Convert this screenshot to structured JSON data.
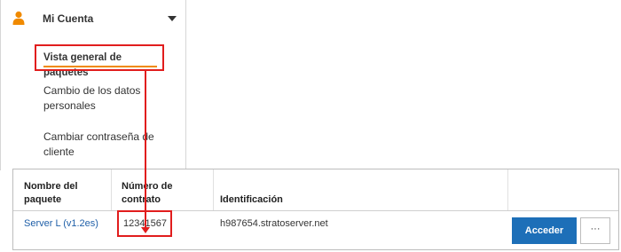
{
  "sidebar": {
    "account_label": "Mi Cuenta",
    "items": [
      {
        "label": "Vista general de paquetes"
      },
      {
        "label": "Cambio de los datos personales"
      },
      {
        "label": "Cambiar contraseña de cliente"
      }
    ]
  },
  "table": {
    "headers": [
      "Nombre del paquete",
      "Número de contrato",
      "Identificación"
    ],
    "rows": [
      {
        "package": "Server L (v1.2es)",
        "contract": "12341567",
        "identification": "h987654.stratoserver.net",
        "action": "Acceder",
        "more": "···"
      }
    ]
  },
  "colors": {
    "accent_underline": "#f08a00",
    "highlight": "#e11d1d",
    "primary_button": "#1d6fb8",
    "link": "#1f5fa8",
    "account_icon": "#f08a00"
  },
  "icons": {
    "account": "user-icon",
    "expand": "chevron-down-icon"
  }
}
